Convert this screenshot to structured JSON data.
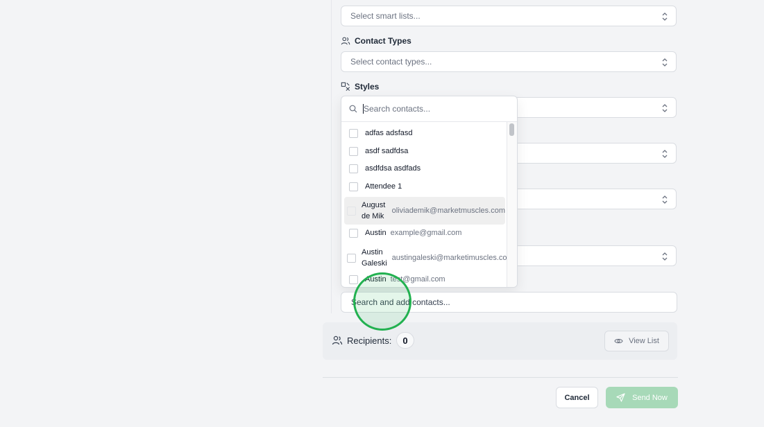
{
  "form": {
    "smart_lists": {
      "placeholder": "Select smart lists..."
    },
    "contact_types": {
      "label": "Contact Types",
      "placeholder": "Select contact types..."
    },
    "styles": {
      "label": "Styles"
    },
    "contacts": {
      "placeholder": "Search and add contacts..."
    }
  },
  "contact_dropdown": {
    "search_placeholder": "Search contacts...",
    "items": [
      {
        "name": "adfas adsfasd",
        "email": ""
      },
      {
        "name": "asdf sadfdsa",
        "email": ""
      },
      {
        "name": "asdfdsa asdfads",
        "email": ""
      },
      {
        "name": "Attendee 1",
        "email": ""
      },
      {
        "name": "August de Mik",
        "email": "oliviademik@marketmuscles.com"
      },
      {
        "name": "Austin",
        "email": "example@gmail.com"
      },
      {
        "name": "Austin Galeski",
        "email": "austingaleski@marketimuscles.com"
      },
      {
        "name": "Austin",
        "email": "test@gmail.com"
      }
    ]
  },
  "recipients": {
    "label": "Recipients:",
    "count": "0",
    "view_list_label": "View List"
  },
  "footer": {
    "cancel_label": "Cancel",
    "send_label": "Send Now"
  },
  "colors": {
    "accent": "#22b150",
    "send_disabled": "#a7d9b8"
  }
}
